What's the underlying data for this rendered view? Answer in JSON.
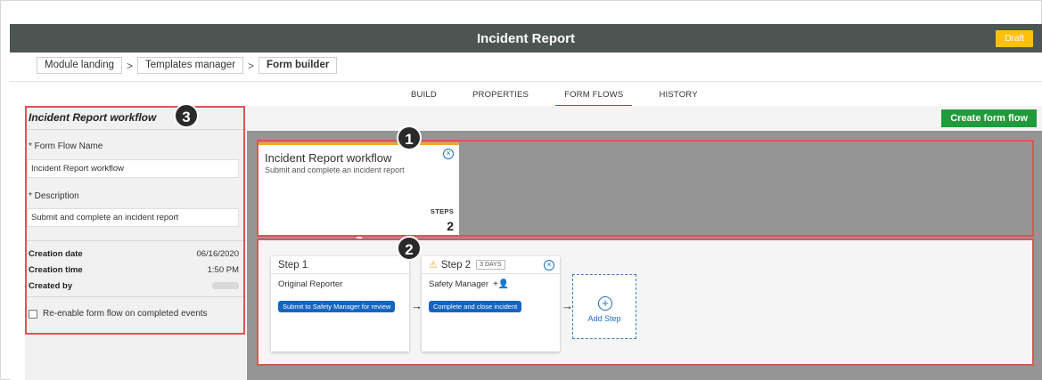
{
  "app": {
    "title": "Incident Report",
    "status_badge": "Draft"
  },
  "breadcrumb": [
    "Module landing",
    "Templates manager",
    "Form builder"
  ],
  "breadcrumb_separator": ">",
  "tabs": [
    {
      "label": "BUILD",
      "active": false
    },
    {
      "label": "PROPERTIES",
      "active": false
    },
    {
      "label": "FORM FLOWS",
      "active": true
    },
    {
      "label": "HISTORY",
      "active": false
    }
  ],
  "side_panel": {
    "title": "Incident Report workflow",
    "name_label": "* Form Flow Name",
    "name_value": "Incident Report workflow",
    "description_label": "* Description",
    "description_value": "Submit and complete an incident report",
    "creation_date_label": "Creation date",
    "creation_date_value": "06/16/2020",
    "creation_time_label": "Creation time",
    "creation_time_value": "1:50 PM",
    "created_by_label": "Created by",
    "reenable_label": "Re-enable form flow on completed events",
    "reenable_checked": false
  },
  "toolbar": {
    "create_label": "Create form flow"
  },
  "flow_card": {
    "name": "Incident Report workflow",
    "description": "Submit and complete an incident report",
    "steps_label": "STEPS",
    "steps_count": "2"
  },
  "steps": [
    {
      "title": "Step 1",
      "role": "Original Reporter",
      "action": "Submit to Safety Manager for review"
    },
    {
      "title": "Step 2",
      "days": "3 DAYS",
      "role": "Safety Manager",
      "action": "Complete and close incident",
      "warning": true
    }
  ],
  "add_step_label": "Add Step",
  "markers": [
    "1",
    "2",
    "3"
  ],
  "colors": {
    "titlebar": "#4d5553",
    "draft": "#ffc107",
    "create_button": "#1f9b3a",
    "highlight_outline": "#e05454",
    "action_pill": "#1565c0",
    "flow_card_accent": "#f5a623"
  },
  "icons": {
    "close": "close-circle-icon",
    "warning": "warning-icon",
    "add_person": "add-person-icon",
    "add": "plus-circle-icon",
    "arrow": "arrow-right-icon"
  }
}
